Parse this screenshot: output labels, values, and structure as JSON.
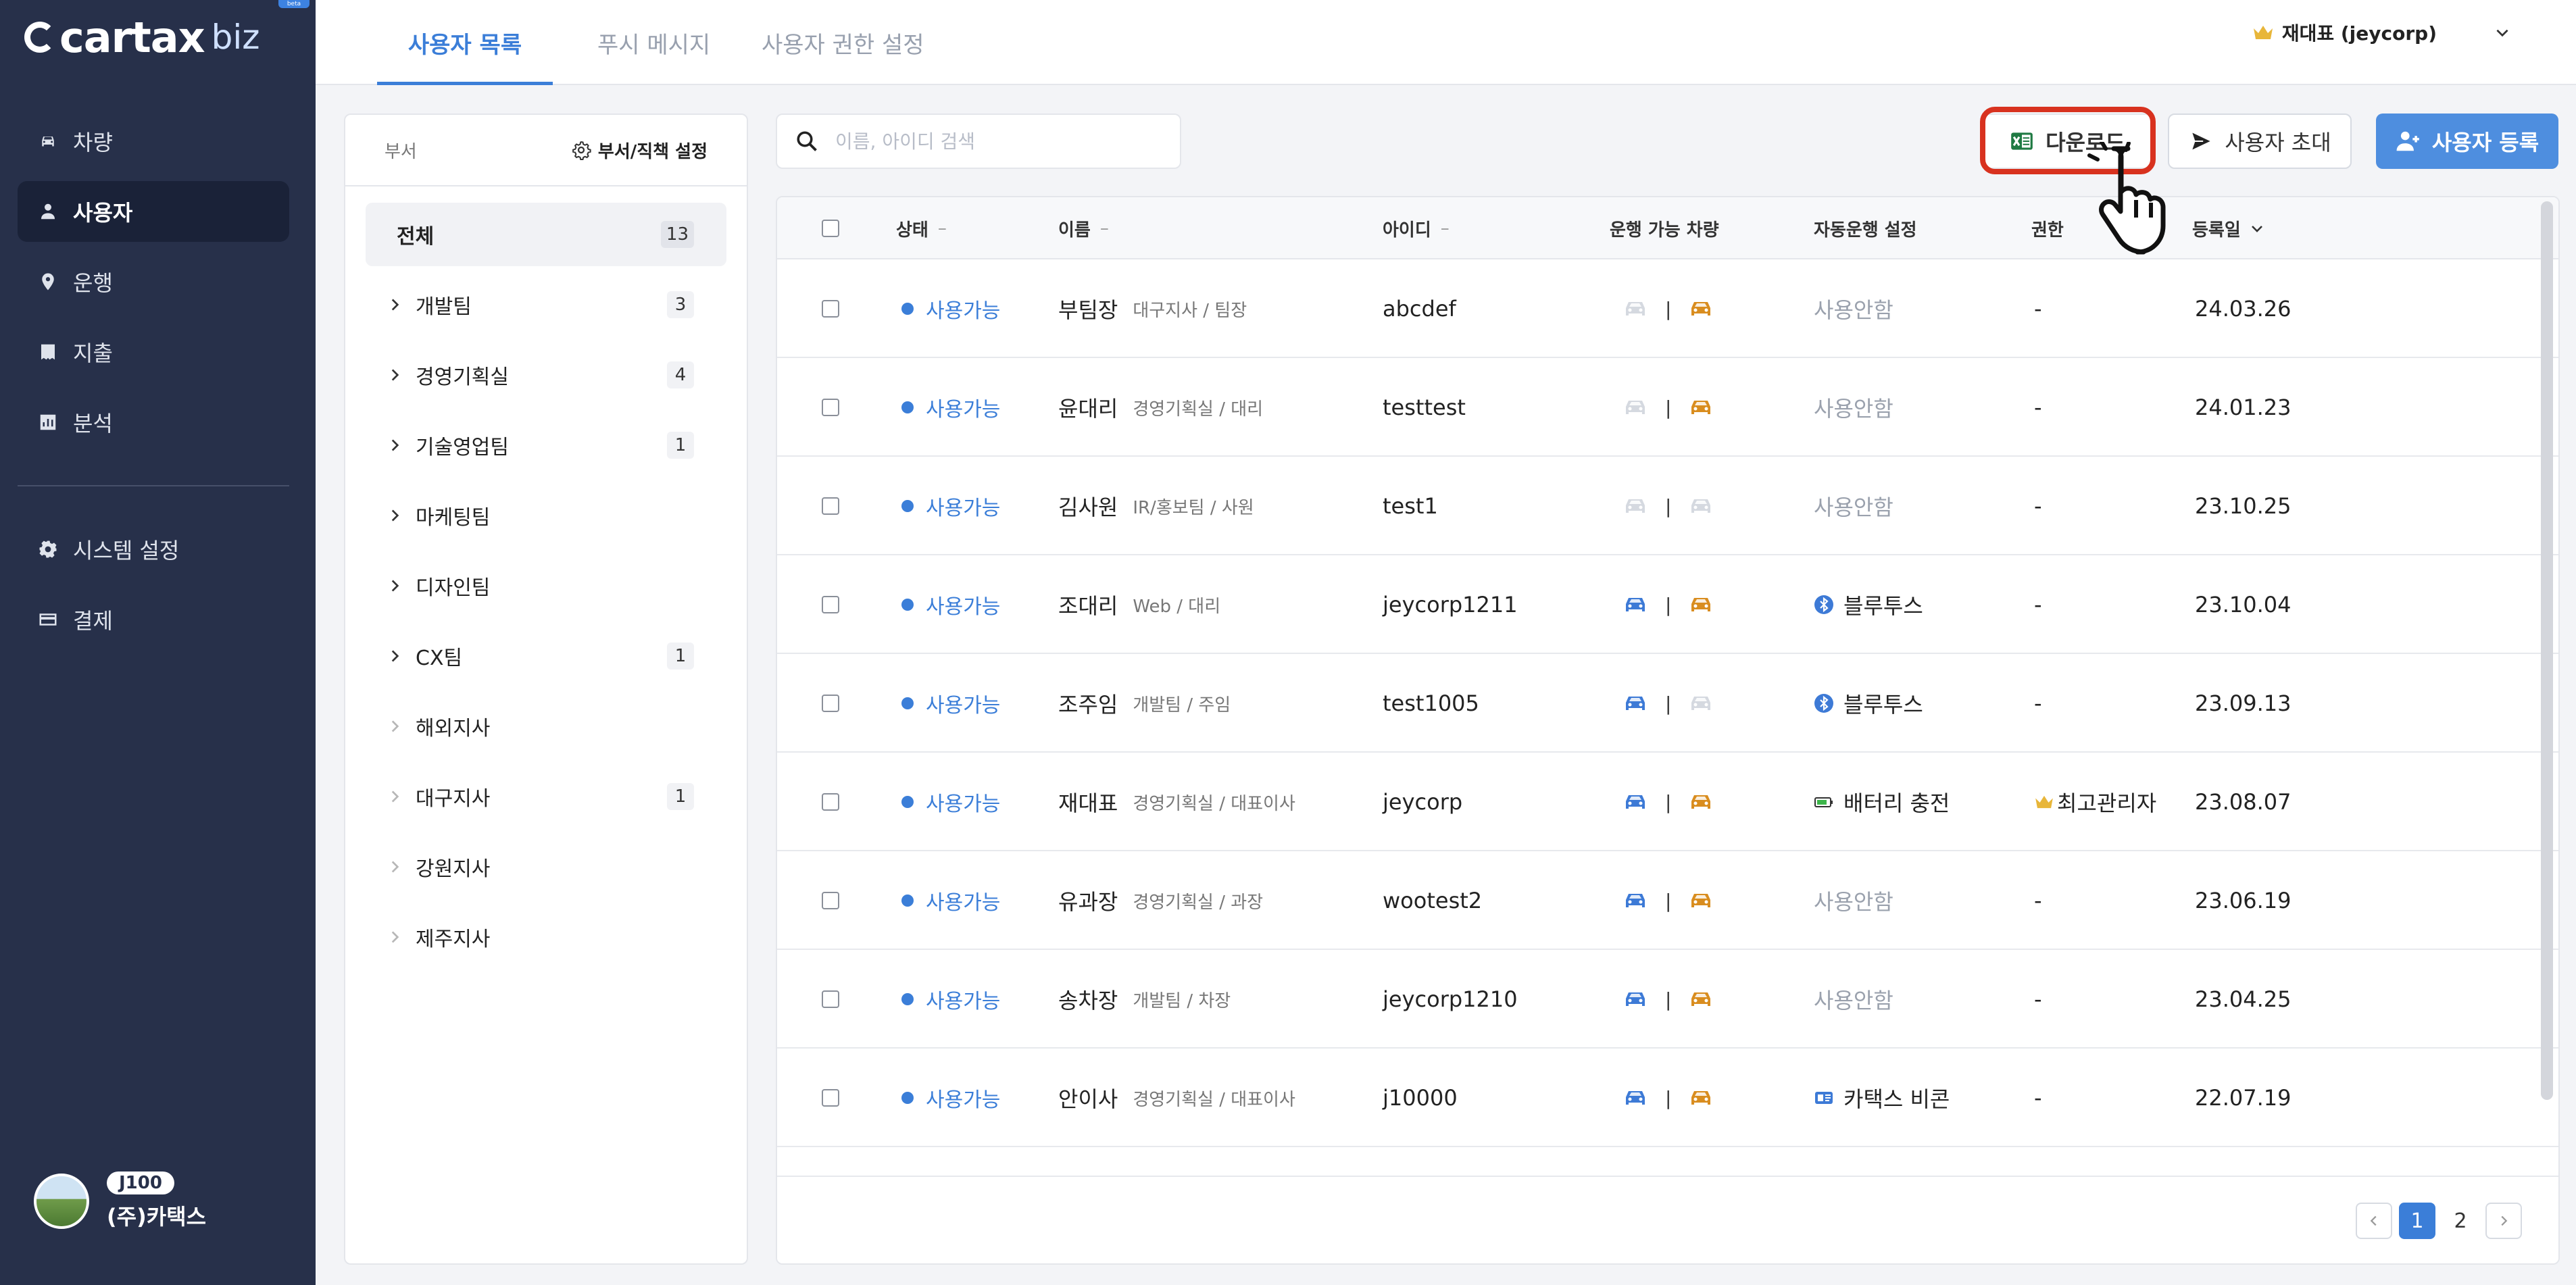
{
  "brand": {
    "logo_text": "cartax",
    "logo_suffix": "biz",
    "beta": "beta"
  },
  "sidebar": {
    "items": [
      {
        "label": "차량",
        "icon": "car-icon"
      },
      {
        "label": "사용자",
        "icon": "person-icon",
        "active": true
      },
      {
        "label": "운행",
        "icon": "location-pin-icon"
      },
      {
        "label": "지출",
        "icon": "receipt-icon"
      },
      {
        "label": "분석",
        "icon": "chart-icon"
      }
    ],
    "items2": [
      {
        "label": "시스템 설정",
        "icon": "gear-icon"
      },
      {
        "label": "결제",
        "icon": "card-icon"
      }
    ],
    "profile": {
      "badge": "J100",
      "name": "(주)카택스"
    }
  },
  "header": {
    "tabs": [
      {
        "label": "사용자 목록",
        "active": true
      },
      {
        "label": "푸시 메시지"
      },
      {
        "label": "사용자 권한 설정"
      }
    ],
    "user_menu": "재대표 (jeycorp)"
  },
  "dept_panel": {
    "title": "부서",
    "settings_label": "부서/직책 설정",
    "items": [
      {
        "label": "전체",
        "count": "13",
        "selected": true
      },
      {
        "label": "개발팀",
        "count": "3"
      },
      {
        "label": "경영기획실",
        "count": "4"
      },
      {
        "label": "기술영업팀",
        "count": "1"
      },
      {
        "label": "마케팅팀",
        "count": ""
      },
      {
        "label": "디자인팀",
        "count": ""
      },
      {
        "label": "CX팀",
        "count": "1"
      },
      {
        "label": "해외지사",
        "count": ""
      },
      {
        "label": "대구지사",
        "count": "1"
      },
      {
        "label": "강원지사",
        "count": ""
      },
      {
        "label": "제주지사",
        "count": ""
      }
    ]
  },
  "toolbar": {
    "search_placeholder": "이름, 아이디 검색",
    "download_label": "다운로드",
    "invite_label": "사용자 초대",
    "add_label": "사용자 등록"
  },
  "table": {
    "headers": {
      "status": "상태",
      "name": "이름",
      "id": "아이디",
      "vehicles": "운행 가능 차량",
      "auto": "자동운행 설정",
      "role": "권한",
      "date": "등록일"
    },
    "sort_mark": "–",
    "rows": [
      {
        "status": "사용가능",
        "name": "부팀장",
        "position": "대구지사 / 팀장",
        "id": "abcdef",
        "car1": false,
        "car2": true,
        "auto": "사용안함",
        "auto_icon": "",
        "role": "-",
        "date": "24.03.26"
      },
      {
        "status": "사용가능",
        "name": "윤대리",
        "position": "경영기획실 / 대리",
        "id": "testtest",
        "car1": false,
        "car2": true,
        "auto": "사용안함",
        "auto_icon": "",
        "role": "-",
        "date": "24.01.23"
      },
      {
        "status": "사용가능",
        "name": "김사원",
        "position": "IR/홍보팀 / 사원",
        "id": "test1",
        "car1": false,
        "car2": false,
        "auto": "사용안함",
        "auto_icon": "",
        "role": "-",
        "date": "23.10.25"
      },
      {
        "status": "사용가능",
        "name": "조대리",
        "position": "Web / 대리",
        "id": "jeycorp1211",
        "car1": true,
        "car2": true,
        "auto": "블루투스",
        "auto_icon": "bluetooth-icon",
        "role": "-",
        "date": "23.10.04"
      },
      {
        "status": "사용가능",
        "name": "조주임",
        "position": "개발팀 / 주임",
        "id": "test1005",
        "car1": true,
        "car2": false,
        "auto": "블루투스",
        "auto_icon": "bluetooth-icon",
        "role": "-",
        "date": "23.09.13"
      },
      {
        "status": "사용가능",
        "name": "재대표",
        "position": "경영기획실 / 대표이사",
        "id": "jeycorp",
        "car1": true,
        "car2": true,
        "auto": "배터리 충전",
        "auto_icon": "battery-icon",
        "role": "최고관리자",
        "date": "23.08.07"
      },
      {
        "status": "사용가능",
        "name": "유과장",
        "position": "경영기획실 / 과장",
        "id": "wootest2",
        "car1": true,
        "car2": true,
        "auto": "사용안함",
        "auto_icon": "",
        "role": "-",
        "date": "23.06.19"
      },
      {
        "status": "사용가능",
        "name": "송차장",
        "position": "개발팀 / 차장",
        "id": "jeycorp1210",
        "car1": true,
        "car2": true,
        "auto": "사용안함",
        "auto_icon": "",
        "role": "-",
        "date": "23.04.25"
      },
      {
        "status": "사용가능",
        "name": "안이사",
        "position": "경영기획실 / 대표이사",
        "id": "j10000",
        "car1": true,
        "car2": true,
        "auto": "카택스 비콘",
        "auto_icon": "beacon-icon",
        "role": "-",
        "date": "22.07.19"
      }
    ]
  },
  "pagination": {
    "pages": [
      "1",
      "2"
    ],
    "current": "1"
  },
  "colors": {
    "accent": "#3b7ed8",
    "sidebar": "#27304a",
    "highlight": "#d8321f",
    "car_blue": "#3d7ad6",
    "car_orange": "#d98d1f"
  }
}
